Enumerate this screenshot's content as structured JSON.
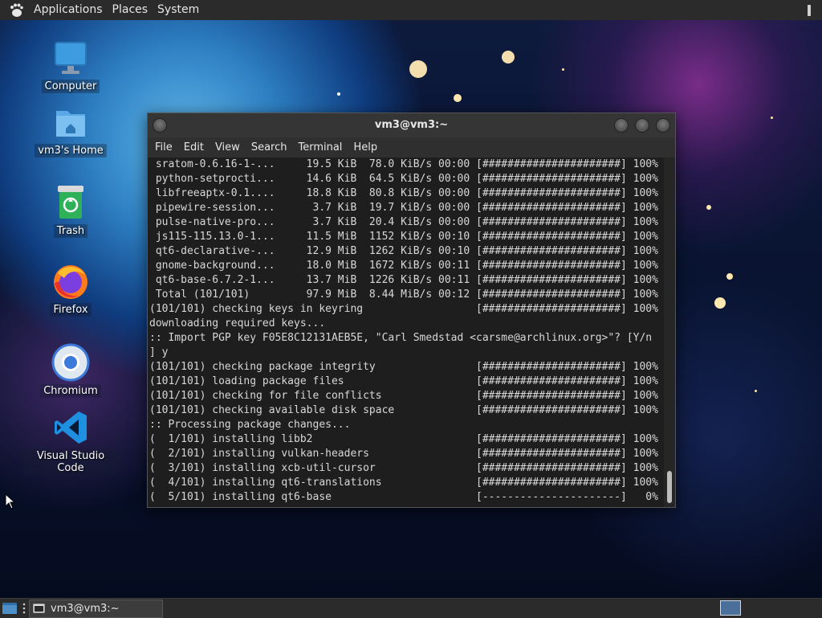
{
  "top_panel": {
    "logo_icon": "gnome-foot-icon",
    "menus": [
      "Applications",
      "Places",
      "System"
    ]
  },
  "desktop_icons": [
    {
      "label": "Computer",
      "icon": "monitor-icon"
    },
    {
      "label": "vm3's Home",
      "icon": "home-folder-icon"
    },
    {
      "label": "Trash",
      "icon": "trash-icon"
    },
    {
      "label": "Firefox",
      "icon": "firefox-icon"
    },
    {
      "label": "Chromium",
      "icon": "chromium-icon"
    },
    {
      "label": "Visual Studio Code",
      "icon": "vscode-icon"
    }
  ],
  "terminal": {
    "title": "vm3@vm3:~",
    "menus": [
      "File",
      "Edit",
      "View",
      "Search",
      "Terminal",
      "Help"
    ],
    "lines": [
      " sratom-0.6.16-1-...     19.5 KiB  78.0 KiB/s 00:00 [######################] 100%",
      " python-setprocti...     14.6 KiB  64.5 KiB/s 00:00 [######################] 100%",
      " libfreeaptx-0.1....     18.8 KiB  80.8 KiB/s 00:00 [######################] 100%",
      " pipewire-session...      3.7 KiB  19.7 KiB/s 00:00 [######################] 100%",
      " pulse-native-pro...      3.7 KiB  20.4 KiB/s 00:00 [######################] 100%",
      " js115-115.13.0-1...     11.5 MiB  1152 KiB/s 00:10 [######################] 100%",
      " qt6-declarative-...     12.9 MiB  1262 KiB/s 00:10 [######################] 100%",
      " gnome-background...     18.0 MiB  1672 KiB/s 00:11 [######################] 100%",
      " qt6-base-6.7.2-1...     13.7 MiB  1226 KiB/s 00:11 [######################] 100%",
      " Total (101/101)         97.9 MiB  8.44 MiB/s 00:12 [######################] 100%",
      "(101/101) checking keys in keyring                  [######################] 100%",
      "downloading required keys...",
      ":: Import PGP key F05E8C12131AEB5E, \"Carl Smedstad <carsme@archlinux.org>\"? [Y/n",
      "] y",
      "(101/101) checking package integrity                [######################] 100%",
      "(101/101) loading package files                     [######################] 100%",
      "(101/101) checking for file conflicts               [######################] 100%",
      "(101/101) checking available disk space             [######################] 100%",
      ":: Processing package changes...",
      "(  1/101) installing libb2                          [######################] 100%",
      "(  2/101) installing vulkan-headers                 [######################] 100%",
      "(  3/101) installing xcb-util-cursor                [######################] 100%",
      "(  4/101) installing qt6-translations               [######################] 100%",
      "(  5/101) installing qt6-base                       [----------------------]   0%"
    ]
  },
  "bottom_panel": {
    "task_label": "vm3@vm3:~",
    "task_icon": "terminal-icon",
    "show_desktop_icon": "show-desktop-icon",
    "workspace_icon": "workspace-switcher-icon"
  }
}
